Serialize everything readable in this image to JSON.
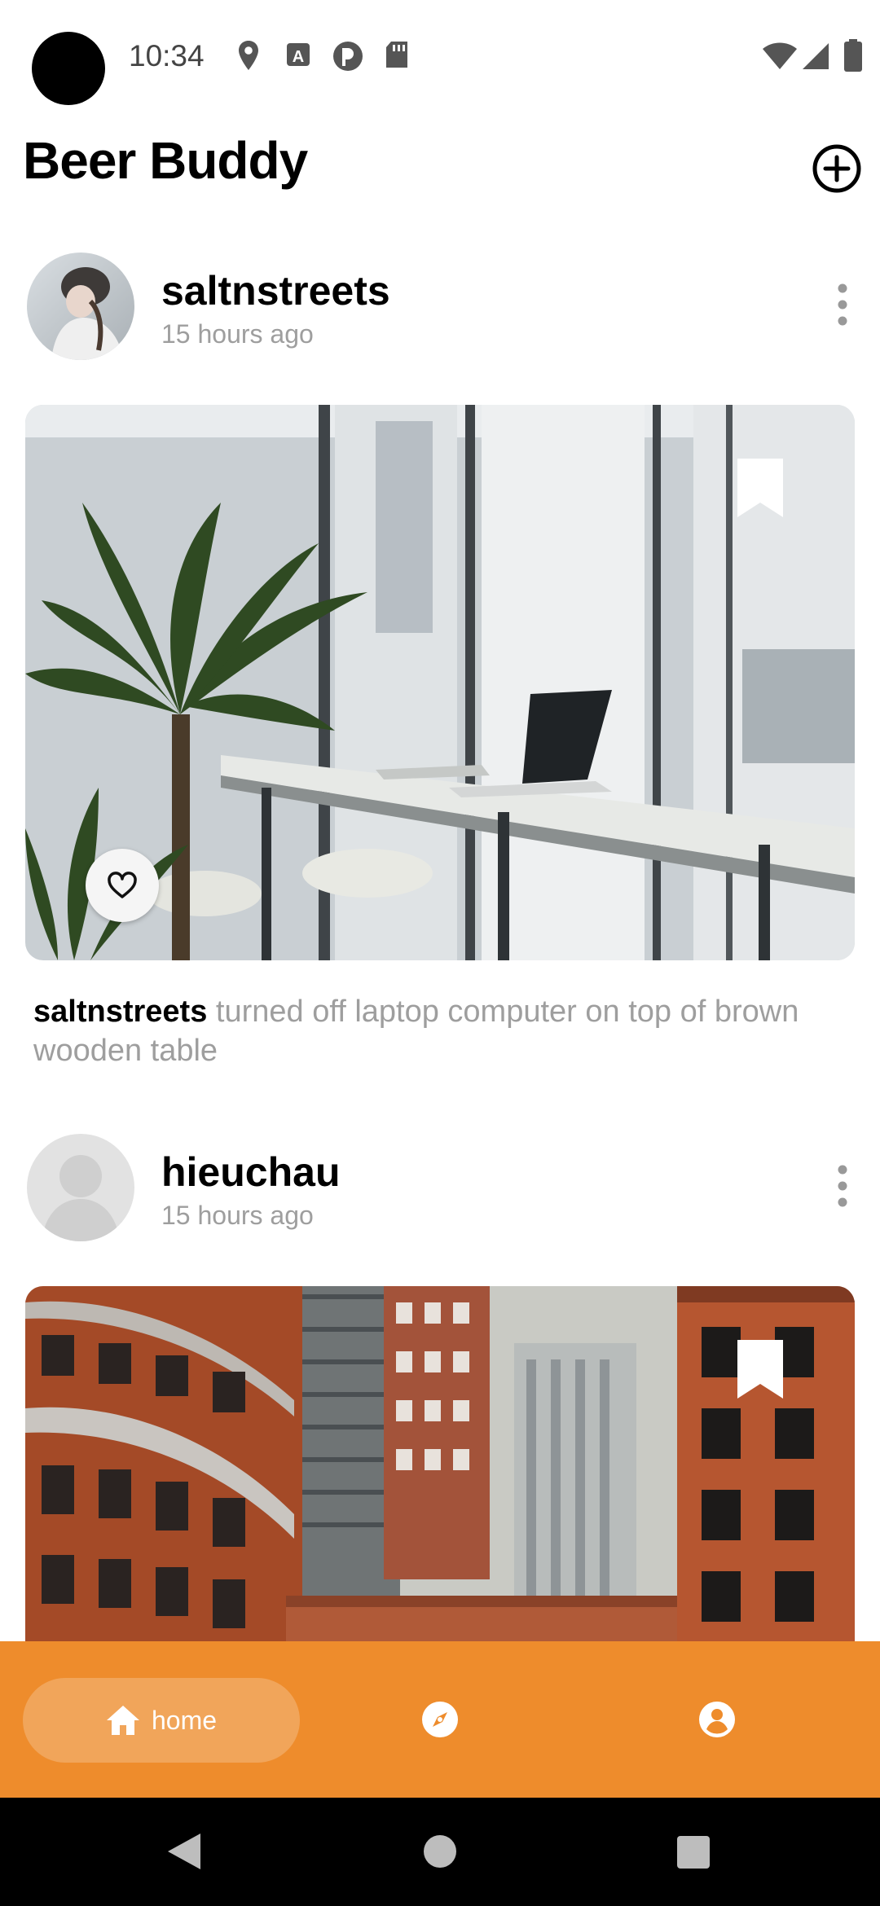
{
  "status_bar": {
    "time": "10:34"
  },
  "app": {
    "title": "Beer Buddy"
  },
  "posts": [
    {
      "username": "saltnstreets",
      "time_ago": "15 hours ago",
      "caption": "turned off laptop computer on top of brown wooden table"
    },
    {
      "username": "hieuchau",
      "time_ago": "15 hours ago"
    }
  ],
  "bottom_nav": {
    "home_label": "home",
    "accent": "#ee8c2c"
  }
}
